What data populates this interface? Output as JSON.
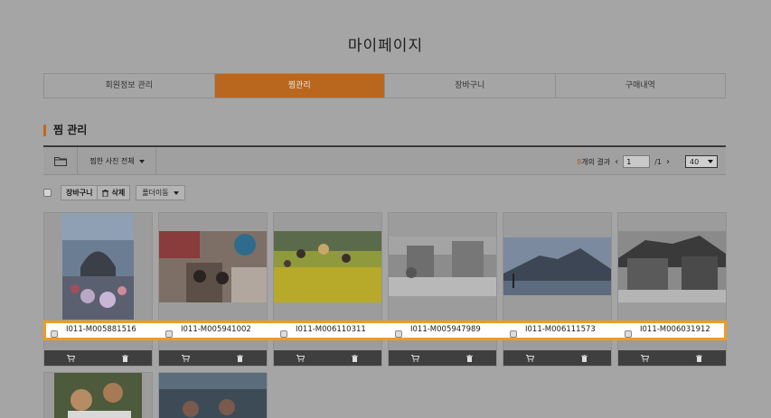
{
  "page_title": "마이페이지",
  "tabs": [
    {
      "label": "회원정보 관리",
      "active": false
    },
    {
      "label": "찜관리",
      "active": true
    },
    {
      "label": "장바구니",
      "active": false
    },
    {
      "label": "구매내역",
      "active": false
    }
  ],
  "section_title": "찜 관리",
  "toolbar": {
    "folder_icon": "folder-icon",
    "filter_label": "찜한 사진 전체",
    "result_count": "8",
    "result_suffix": "개의 결과",
    "page_current": "1",
    "page_total": "/1",
    "per_page": "40"
  },
  "actions": {
    "cart_label": "장바구니",
    "delete_label": "삭제",
    "folder_move_label": "폴더이동"
  },
  "items": [
    {
      "code": "I011-M005881516"
    },
    {
      "code": "I011-M005941002"
    },
    {
      "code": "I011-M006110311"
    },
    {
      "code": "I011-M005947989"
    },
    {
      "code": "I011-M006111573"
    },
    {
      "code": "I011-M006031912"
    },
    {
      "code": ""
    },
    {
      "code": ""
    }
  ],
  "colors": {
    "accent": "#b9661e",
    "highlight_border": "#ef9b22",
    "card_bar": "#3f3f3f"
  }
}
